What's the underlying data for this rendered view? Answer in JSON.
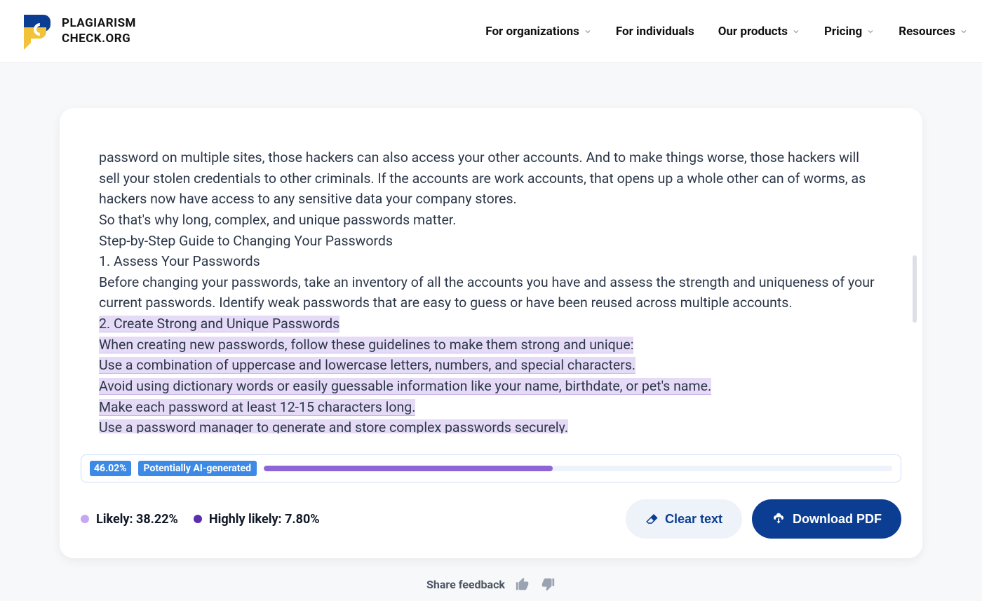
{
  "brand": {
    "line1": "PLAGIARISM",
    "line2": "CHECK.ORG"
  },
  "nav": {
    "organizations": "For organizations",
    "individuals": "For individuals",
    "products": "Our products",
    "pricing": "Pricing",
    "resources": "Resources"
  },
  "content": {
    "p1": "password on multiple sites, those hackers can also access your other accounts. And to make things worse, those hackers will sell your stolen credentials to other criminals. If the accounts are work accounts, that opens up a whole other can of worms, as hackers now have access to any sensitive data your company stores.",
    "p2": "So that's why long, complex, and unique passwords matter.",
    "p3": "Step-by-Step Guide to Changing Your Passwords",
    "p4": "1. Assess Your Passwords",
    "p5": "Before changing your passwords, take an inventory of all the accounts you have and assess the strength and uniqueness of your current passwords. Identify weak passwords that are easy to guess or have been reused across multiple accounts.",
    "h1": "2. Create Strong and Unique Passwords",
    "h2": "When creating new passwords, follow these guidelines to make them strong and unique:",
    "h3": "Use a combination of uppercase and lowercase letters, numbers, and special characters.",
    "h4": "Avoid using dictionary words or easily guessable information like your name, birthdate, or pet's name.",
    "h5": "Make each password at least 12-15 characters long.",
    "h6": "Use a password manager to generate and store complex passwords securely."
  },
  "meter": {
    "percent": "46.02%",
    "label": "Potentially AI-generated",
    "fillPercent": "46.02%"
  },
  "legend": {
    "likelyLabel": "Likely: 38.22%",
    "highlyLabel": "Highly likely: 7.80%"
  },
  "actions": {
    "clear": "Clear text",
    "download": "Download PDF"
  },
  "feedback": {
    "label": "Share feedback"
  }
}
